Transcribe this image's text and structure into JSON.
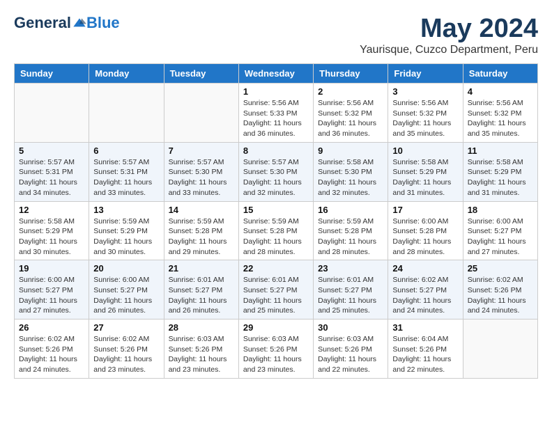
{
  "logo": {
    "general": "General",
    "blue": "Blue"
  },
  "header": {
    "title": "May 2024",
    "subtitle": "Yaurisque, Cuzco Department, Peru"
  },
  "weekdays": [
    "Sunday",
    "Monday",
    "Tuesday",
    "Wednesday",
    "Thursday",
    "Friday",
    "Saturday"
  ],
  "weeks": [
    [
      {
        "day": "",
        "info": ""
      },
      {
        "day": "",
        "info": ""
      },
      {
        "day": "",
        "info": ""
      },
      {
        "day": "1",
        "info": "Sunrise: 5:56 AM\nSunset: 5:33 PM\nDaylight: 11 hours and 36 minutes."
      },
      {
        "day": "2",
        "info": "Sunrise: 5:56 AM\nSunset: 5:32 PM\nDaylight: 11 hours and 36 minutes."
      },
      {
        "day": "3",
        "info": "Sunrise: 5:56 AM\nSunset: 5:32 PM\nDaylight: 11 hours and 35 minutes."
      },
      {
        "day": "4",
        "info": "Sunrise: 5:56 AM\nSunset: 5:32 PM\nDaylight: 11 hours and 35 minutes."
      }
    ],
    [
      {
        "day": "5",
        "info": "Sunrise: 5:57 AM\nSunset: 5:31 PM\nDaylight: 11 hours and 34 minutes."
      },
      {
        "day": "6",
        "info": "Sunrise: 5:57 AM\nSunset: 5:31 PM\nDaylight: 11 hours and 33 minutes."
      },
      {
        "day": "7",
        "info": "Sunrise: 5:57 AM\nSunset: 5:30 PM\nDaylight: 11 hours and 33 minutes."
      },
      {
        "day": "8",
        "info": "Sunrise: 5:57 AM\nSunset: 5:30 PM\nDaylight: 11 hours and 32 minutes."
      },
      {
        "day": "9",
        "info": "Sunrise: 5:58 AM\nSunset: 5:30 PM\nDaylight: 11 hours and 32 minutes."
      },
      {
        "day": "10",
        "info": "Sunrise: 5:58 AM\nSunset: 5:29 PM\nDaylight: 11 hours and 31 minutes."
      },
      {
        "day": "11",
        "info": "Sunrise: 5:58 AM\nSunset: 5:29 PM\nDaylight: 11 hours and 31 minutes."
      }
    ],
    [
      {
        "day": "12",
        "info": "Sunrise: 5:58 AM\nSunset: 5:29 PM\nDaylight: 11 hours and 30 minutes."
      },
      {
        "day": "13",
        "info": "Sunrise: 5:59 AM\nSunset: 5:29 PM\nDaylight: 11 hours and 30 minutes."
      },
      {
        "day": "14",
        "info": "Sunrise: 5:59 AM\nSunset: 5:28 PM\nDaylight: 11 hours and 29 minutes."
      },
      {
        "day": "15",
        "info": "Sunrise: 5:59 AM\nSunset: 5:28 PM\nDaylight: 11 hours and 28 minutes."
      },
      {
        "day": "16",
        "info": "Sunrise: 5:59 AM\nSunset: 5:28 PM\nDaylight: 11 hours and 28 minutes."
      },
      {
        "day": "17",
        "info": "Sunrise: 6:00 AM\nSunset: 5:28 PM\nDaylight: 11 hours and 28 minutes."
      },
      {
        "day": "18",
        "info": "Sunrise: 6:00 AM\nSunset: 5:27 PM\nDaylight: 11 hours and 27 minutes."
      }
    ],
    [
      {
        "day": "19",
        "info": "Sunrise: 6:00 AM\nSunset: 5:27 PM\nDaylight: 11 hours and 27 minutes."
      },
      {
        "day": "20",
        "info": "Sunrise: 6:00 AM\nSunset: 5:27 PM\nDaylight: 11 hours and 26 minutes."
      },
      {
        "day": "21",
        "info": "Sunrise: 6:01 AM\nSunset: 5:27 PM\nDaylight: 11 hours and 26 minutes."
      },
      {
        "day": "22",
        "info": "Sunrise: 6:01 AM\nSunset: 5:27 PM\nDaylight: 11 hours and 25 minutes."
      },
      {
        "day": "23",
        "info": "Sunrise: 6:01 AM\nSunset: 5:27 PM\nDaylight: 11 hours and 25 minutes."
      },
      {
        "day": "24",
        "info": "Sunrise: 6:02 AM\nSunset: 5:27 PM\nDaylight: 11 hours and 24 minutes."
      },
      {
        "day": "25",
        "info": "Sunrise: 6:02 AM\nSunset: 5:26 PM\nDaylight: 11 hours and 24 minutes."
      }
    ],
    [
      {
        "day": "26",
        "info": "Sunrise: 6:02 AM\nSunset: 5:26 PM\nDaylight: 11 hours and 24 minutes."
      },
      {
        "day": "27",
        "info": "Sunrise: 6:02 AM\nSunset: 5:26 PM\nDaylight: 11 hours and 23 minutes."
      },
      {
        "day": "28",
        "info": "Sunrise: 6:03 AM\nSunset: 5:26 PM\nDaylight: 11 hours and 23 minutes."
      },
      {
        "day": "29",
        "info": "Sunrise: 6:03 AM\nSunset: 5:26 PM\nDaylight: 11 hours and 23 minutes."
      },
      {
        "day": "30",
        "info": "Sunrise: 6:03 AM\nSunset: 5:26 PM\nDaylight: 11 hours and 22 minutes."
      },
      {
        "day": "31",
        "info": "Sunrise: 6:04 AM\nSunset: 5:26 PM\nDaylight: 11 hours and 22 minutes."
      },
      {
        "day": "",
        "info": ""
      }
    ]
  ]
}
